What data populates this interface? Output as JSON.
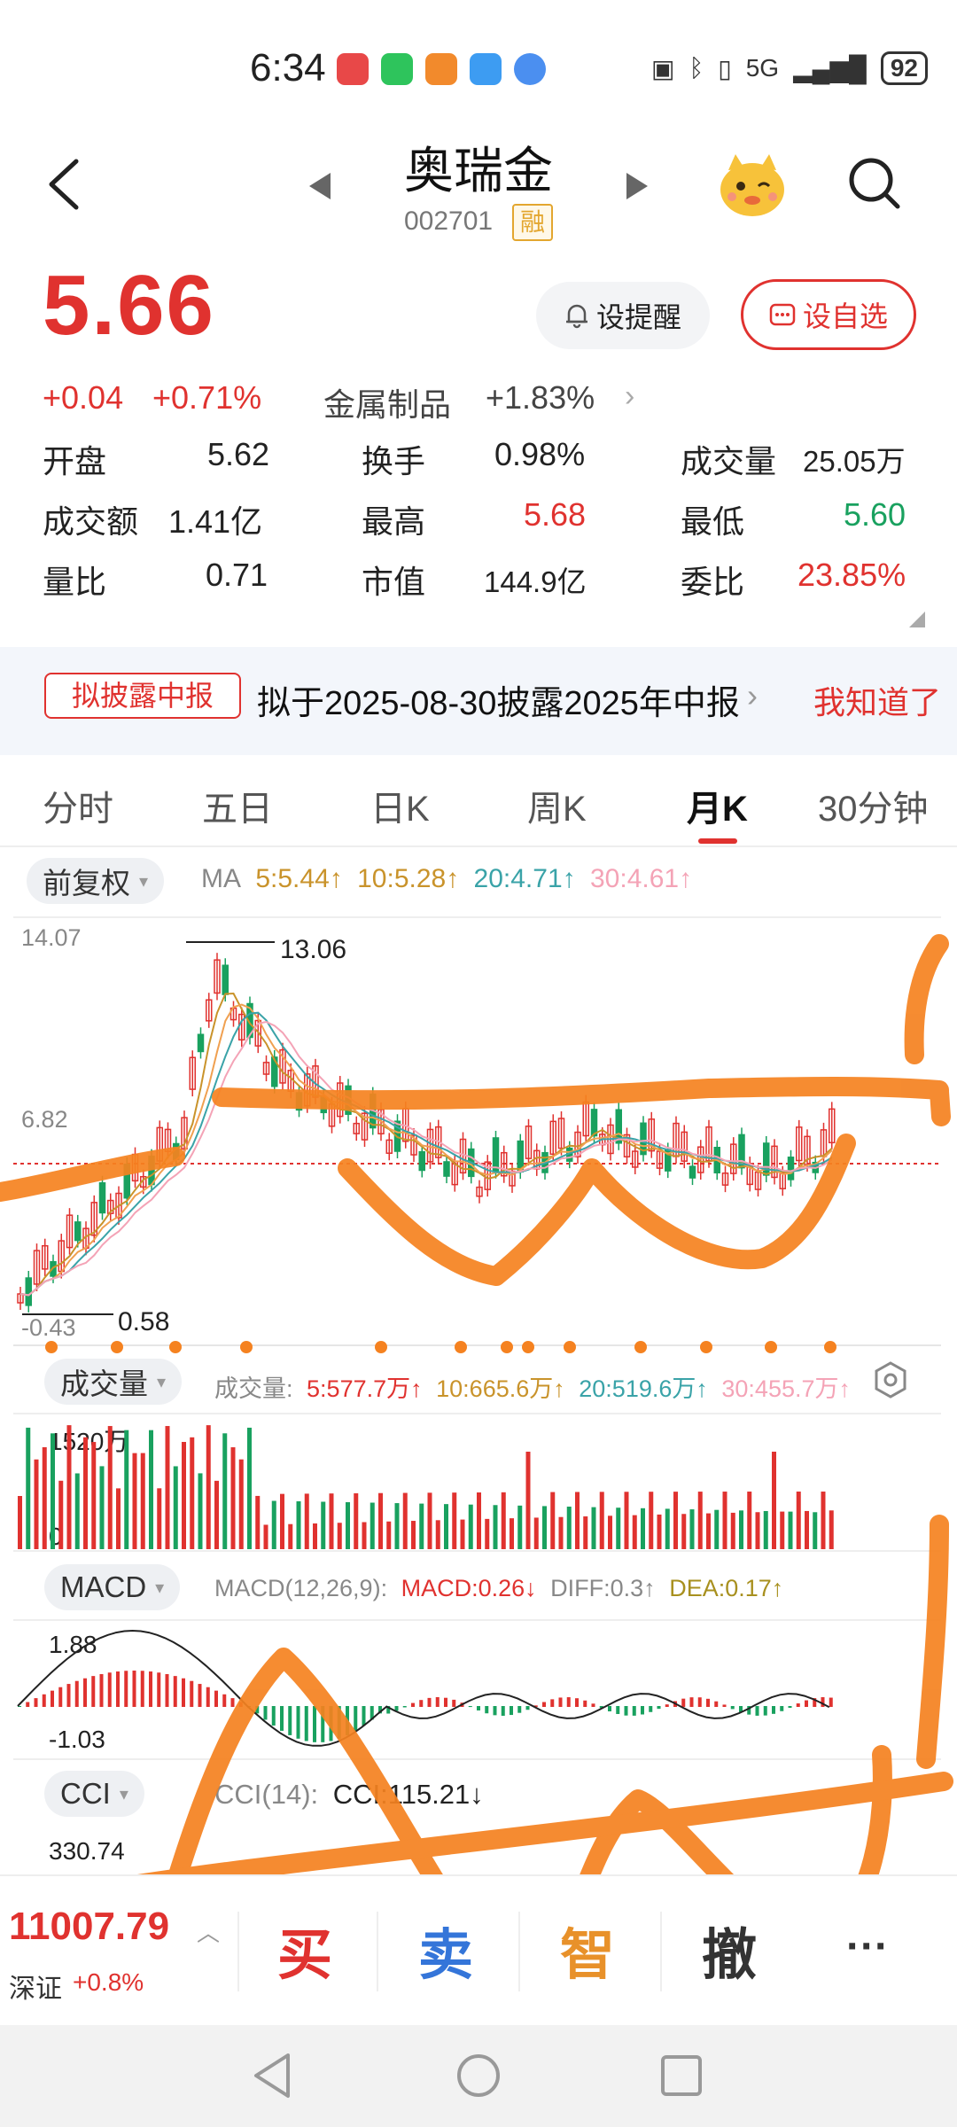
{
  "status_bar": {
    "time": "6:34",
    "network": "5G",
    "battery": "92"
  },
  "header": {
    "stock_name": "奥瑞金",
    "stock_code": "002701",
    "margin_badge": "融"
  },
  "quote": {
    "price": "5.66",
    "change": "+0.04",
    "change_pct": "+0.71%",
    "sector_name": "金属制品",
    "sector_change": "+1.83%",
    "remind_label": "设提醒",
    "watchlist_label": "设自选"
  },
  "stats": [
    [
      {
        "label": "开盘",
        "value": "5.62"
      },
      {
        "label": "换手",
        "value": "0.98%"
      },
      {
        "label": "成交量",
        "value": "25.05万"
      }
    ],
    [
      {
        "label": "成交额",
        "value": "1.41亿"
      },
      {
        "label": "最高",
        "value": "5.68"
      },
      {
        "label": "最低",
        "value": "5.60"
      }
    ],
    [
      {
        "label": "量比",
        "value": "0.71"
      },
      {
        "label": "市值",
        "value": "144.9亿"
      },
      {
        "label": "委比",
        "value": "23.85%"
      }
    ]
  ],
  "notice": {
    "tag": "拟披露中报",
    "text": "拟于2025-08-30披露2025年中报",
    "ack": "我知道了"
  },
  "tabs": [
    "分时",
    "五日",
    "日K",
    "周K",
    "月K",
    "30分钟"
  ],
  "active_tab": "月K",
  "kline": {
    "adjust_label": "前复权",
    "ma_title": "MA",
    "ma": [
      {
        "text": "5:5.44↑",
        "color": "#c9932b"
      },
      {
        "text": "10:5.28↑",
        "color": "#c9932b"
      },
      {
        "text": "20:4.71↑",
        "color": "#3aa3a8"
      },
      {
        "text": "30:4.61↑",
        "color": "#f4a3b6"
      }
    ],
    "y_top": "14.07",
    "y_mid": "6.82",
    "y_bottom": "-0.43",
    "high_marker": "13.06",
    "low_marker": "0.58"
  },
  "volume": {
    "label": "成交量",
    "prefix": "成交量:",
    "ma": [
      "5:577.7万↑",
      "10:665.6万↑",
      "20:519.6万↑",
      "30:455.7万↑"
    ],
    "y_top": "1520万",
    "y_zero": "0"
  },
  "macd": {
    "label": "MACD",
    "params": "MACD(12,26,9):",
    "macd": "MACD:0.26↓",
    "diff": "DIFF:0.3↑",
    "dea": "DEA:0.17↑",
    "y_top": "1.88",
    "y_bottom": "-1.03"
  },
  "cci": {
    "label": "CCI",
    "params": "CCI(14):",
    "value": "CCI:115.21↓",
    "y_top": "330.74"
  },
  "bottom_bar": {
    "index_value": "11007.79",
    "index_name": "深证",
    "index_change": "+0.8%",
    "buy": "买",
    "sell": "卖",
    "smart": "智",
    "cancel": "撤",
    "more": "···"
  },
  "colors": {
    "up": "#e0322f",
    "down": "#19a15f",
    "annotation": "#f58220"
  }
}
